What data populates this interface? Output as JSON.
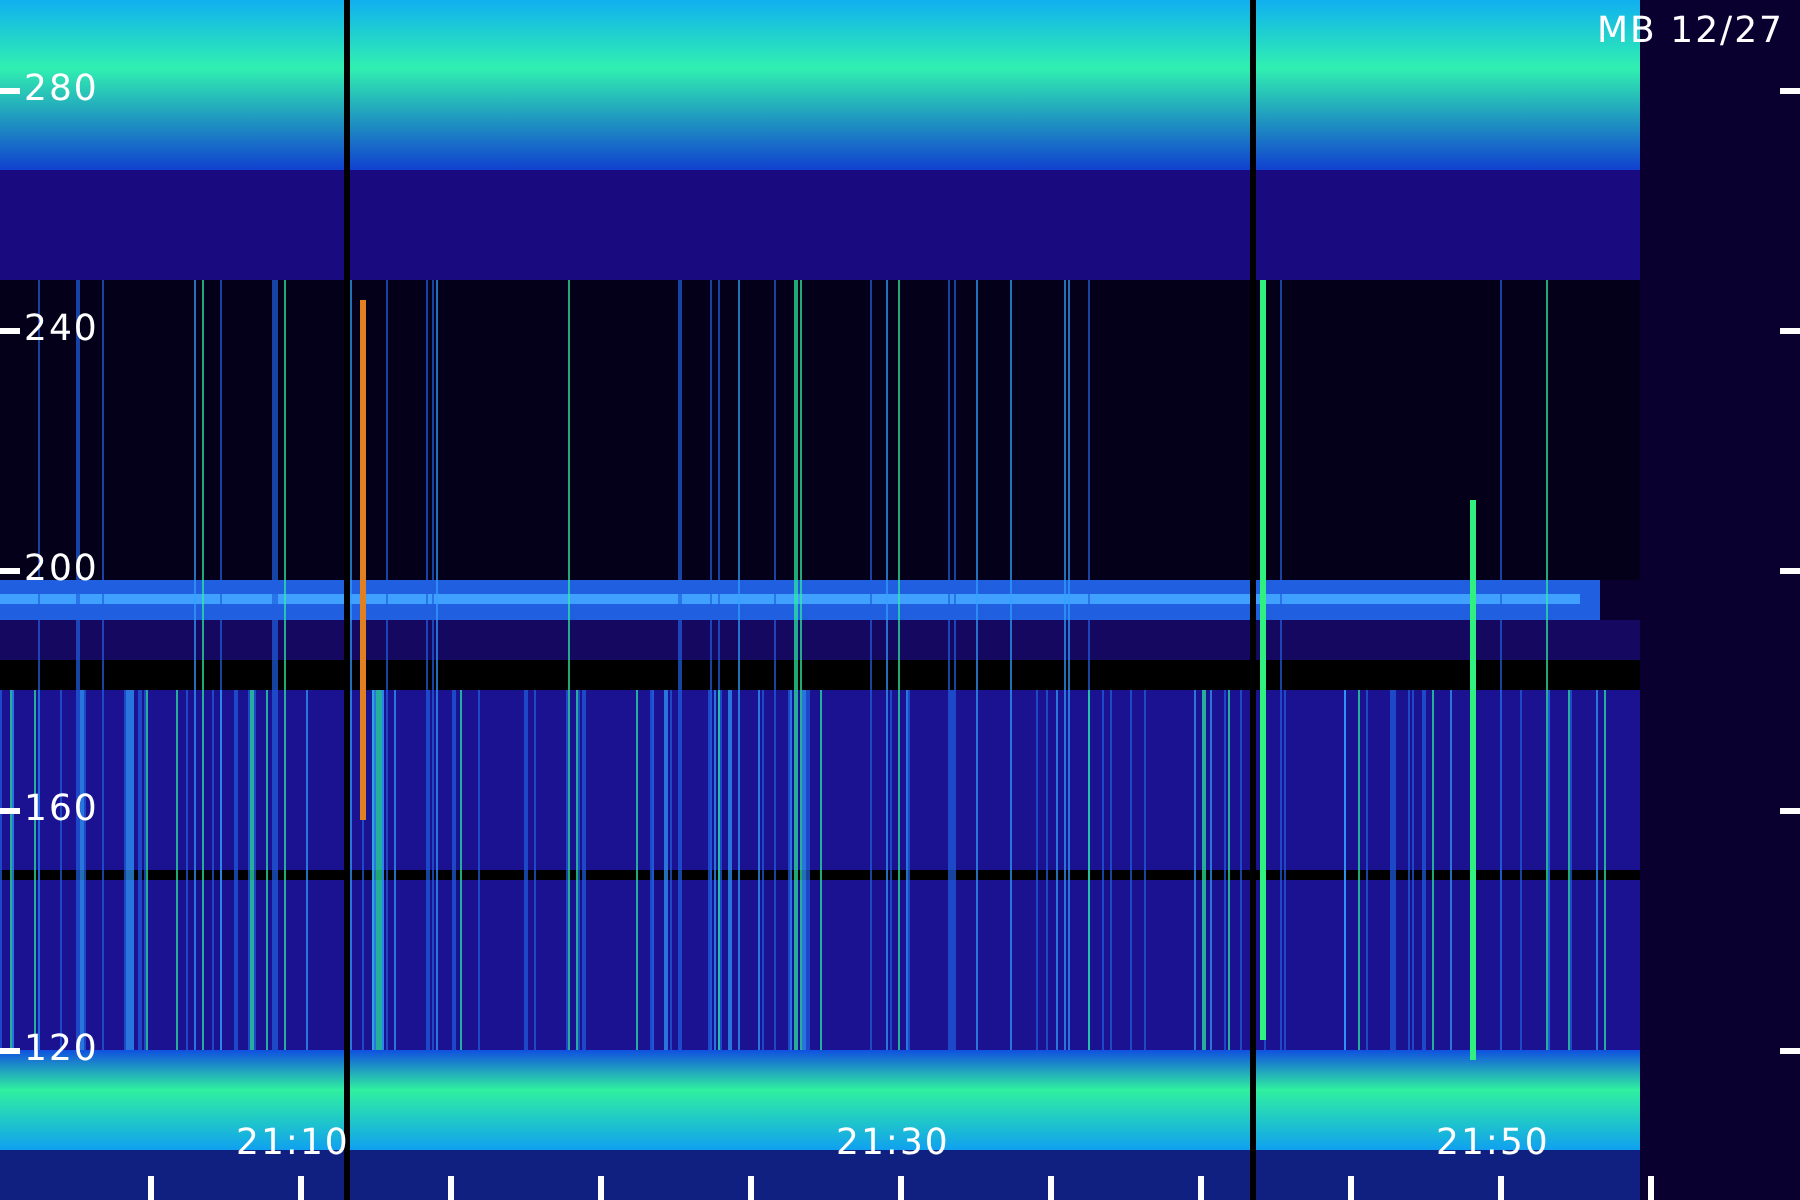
{
  "corner_label": "MB 12/27",
  "frequency_axis": {
    "labels": [
      "280",
      "240",
      "200",
      "160",
      "120"
    ]
  },
  "time_axis": {
    "labels": [
      "21:10",
      "21:30",
      "21:50"
    ]
  }
}
